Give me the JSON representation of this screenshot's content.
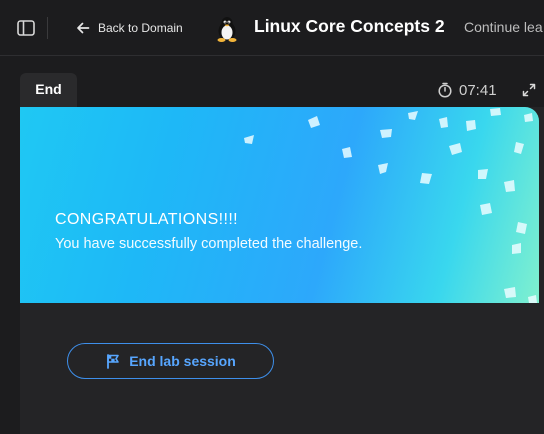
{
  "header": {
    "back_label": "Back to Domain",
    "title": "Linux Core Concepts 2",
    "continue_label": "Continue lea",
    "icons": {
      "sidebar": "sidebar-toggle-icon",
      "back": "arrow-left-icon",
      "logo": "tux-penguin-icon"
    }
  },
  "lab": {
    "tab_label": "End",
    "timer": "07:41",
    "icons": {
      "timer": "stopwatch-icon",
      "expand": "fullscreen-icon"
    }
  },
  "result": {
    "headline": "CONGRATULATIONS!!!!",
    "message": "You have successfully completed the challenge."
  },
  "actions": {
    "end_label": "End lab session",
    "end_icon": "flag-icon"
  },
  "colors": {
    "background": "#1c1c1e",
    "panel": "#242426",
    "accent": "#57a6ff",
    "banner_from": "#1fc8f3",
    "banner_to": "#7ff0cf"
  }
}
